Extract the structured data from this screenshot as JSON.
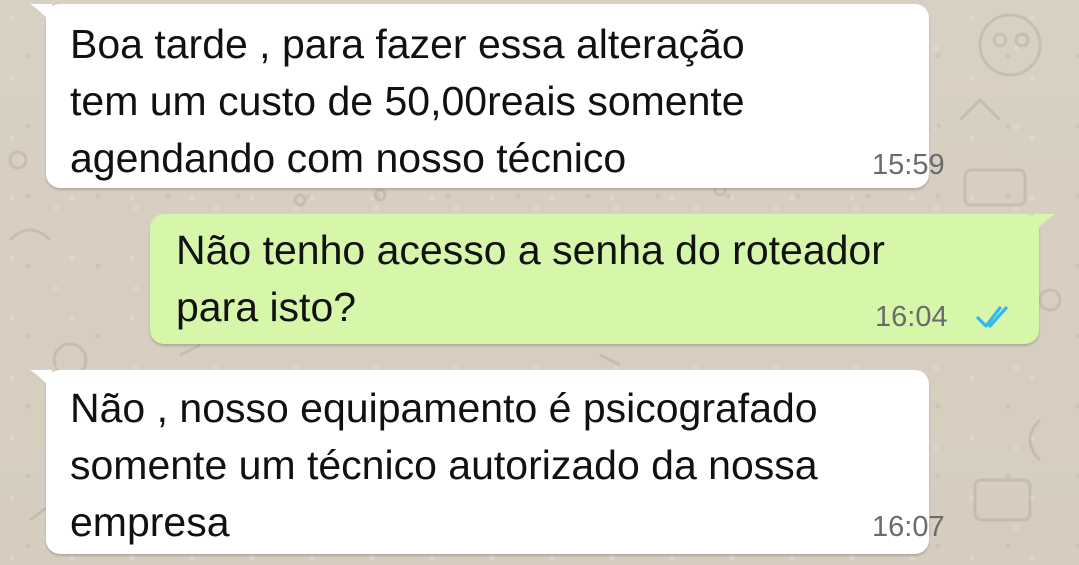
{
  "messages": [
    {
      "direction": "incoming",
      "text": "Boa tarde , para fazer essa alteração\ntem um custo de 50,00reais somente\nagendando com nosso técnico",
      "time": "15:59"
    },
    {
      "direction": "outgoing",
      "text": "Não tenho acesso a senha do roteador\npara isto?",
      "time": "16:04",
      "status_icon": "double-check-read-icon",
      "status_color": "#34b7f1"
    },
    {
      "direction": "incoming",
      "text": "Não , nosso equipamento é psicografado\nsomente um técnico autorizado da nossa\nempresa",
      "time": "16:07"
    }
  ],
  "colors": {
    "background": "#d7cfc3",
    "incoming_bubble": "#ffffff",
    "outgoing_bubble": "#d6f7a9",
    "timestamp": "#6b6b6b"
  }
}
